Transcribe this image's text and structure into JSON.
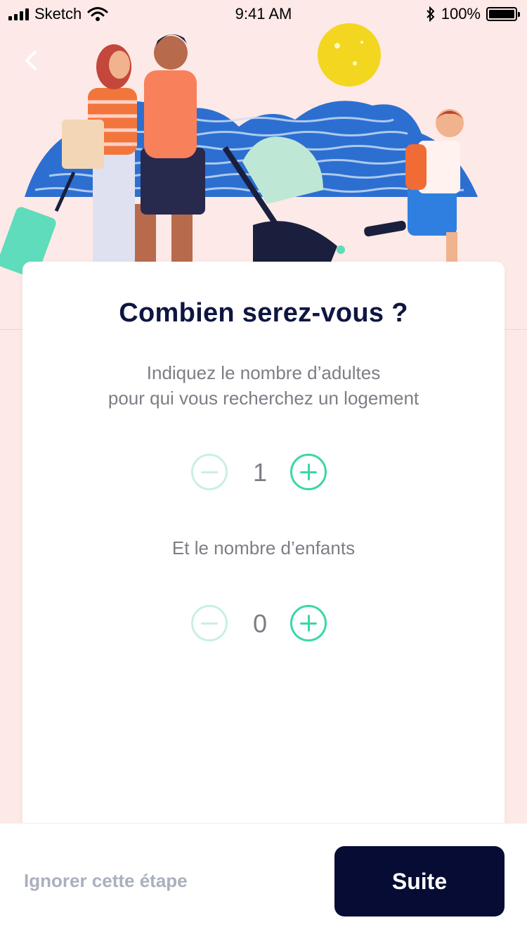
{
  "status_bar": {
    "carrier": "Sketch",
    "time": "9:41 AM",
    "battery_text": "100%",
    "battery_level": 1.0
  },
  "nav": {
    "back_icon": "chevron-left-icon"
  },
  "card": {
    "title": "Combien serez-vous ?",
    "subtitle_line1": "Indiquez le nombre d’adultes",
    "subtitle_line2": "pour qui vous recherchez un logement",
    "adults": {
      "value": "1"
    },
    "children_label": "Et le nombre d’enfants",
    "children": {
      "value": "0"
    }
  },
  "footer": {
    "skip_label": "Ignorer cette étape",
    "next_label": "Suite"
  },
  "colors": {
    "background": "#fde9e7",
    "primary_dark": "#060c33",
    "accent_green": "#3bd6a8",
    "accent_green_disabled": "#c8f0e4",
    "title": "#0e1640",
    "muted_text": "#7d7d86"
  }
}
